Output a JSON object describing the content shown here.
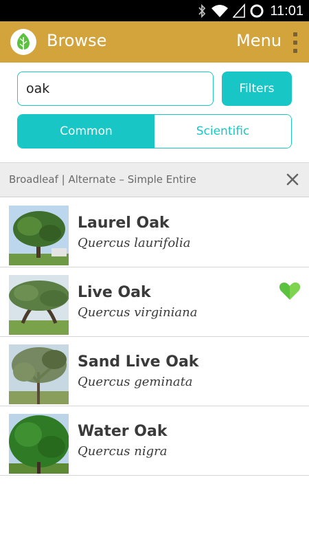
{
  "status_bar": {
    "time": "11:01",
    "icons": [
      "bluetooth-icon",
      "wifi-icon",
      "signal-icon",
      "sync-icon"
    ]
  },
  "app_bar": {
    "title": "Browse",
    "menu_label": "Menu",
    "logo_icon": "leaf-icon",
    "overflow_icon": "overflow-menu-icon"
  },
  "search": {
    "value": "oak",
    "filters_label": "Filters"
  },
  "name_toggle": {
    "common_label": "Common",
    "scientific_label": "Scientific",
    "selected": "Common"
  },
  "filter_bar": {
    "text": "Broadleaf | Alternate – Simple Entire",
    "close_icon": "close-icon"
  },
  "results": [
    {
      "common_name": "Laurel Oak",
      "scientific_name": "Quercus laurifolia",
      "favorite": false
    },
    {
      "common_name": "Live Oak",
      "scientific_name": "Quercus virginiana",
      "favorite": true
    },
    {
      "common_name": "Sand Live Oak",
      "scientific_name": "Quercus geminata",
      "favorite": false
    },
    {
      "common_name": "Water Oak",
      "scientific_name": "Quercus nigra",
      "favorite": false
    }
  ],
  "colors": {
    "app_bar": "#d3a33c",
    "accent": "#18c7c5",
    "favorite": "#5cc13f"
  }
}
